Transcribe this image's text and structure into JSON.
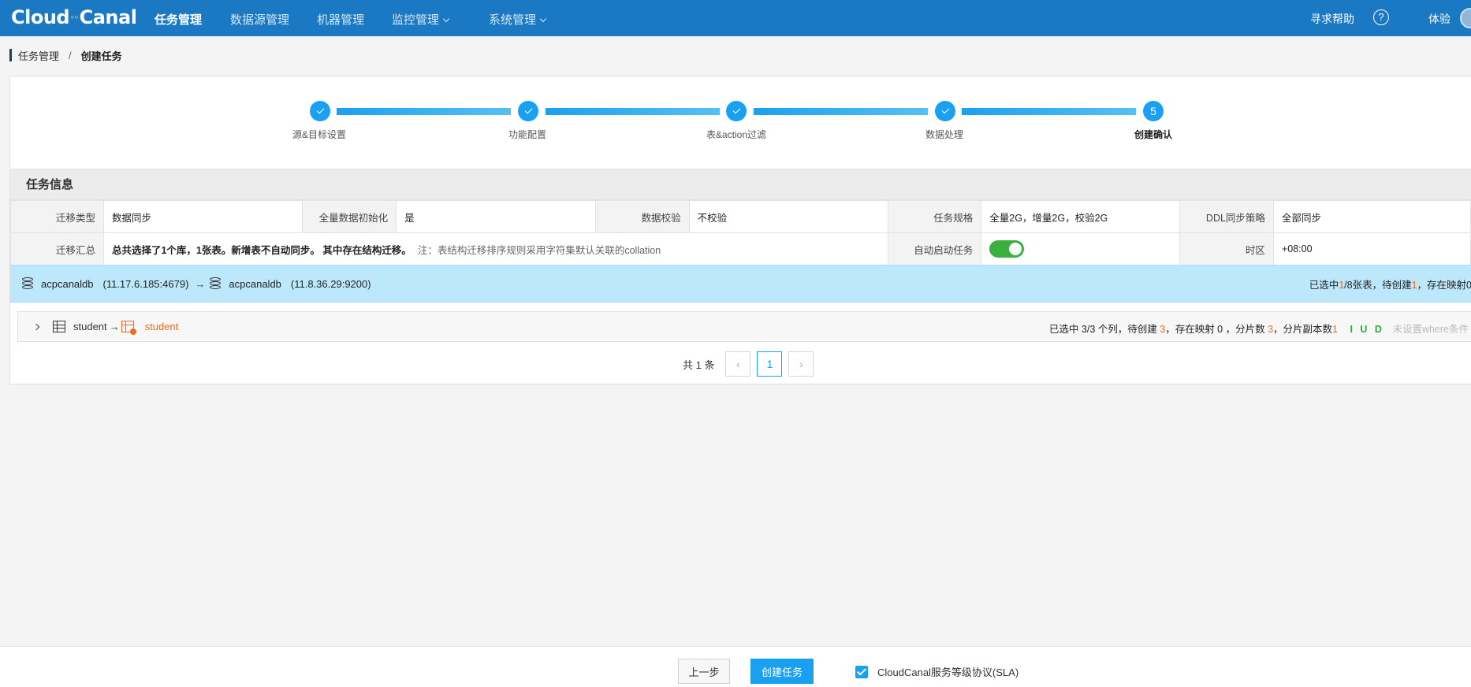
{
  "nav": {
    "logo": "Cloud",
    "logo_mid": "Canal",
    "items": [
      {
        "label": "任务管理"
      },
      {
        "label": "数据源管理"
      },
      {
        "label": "机器管理"
      },
      {
        "label": "监控管理"
      },
      {
        "label": "系统管理"
      }
    ],
    "help": "寻求帮助",
    "help_icon": "?",
    "user": "体验"
  },
  "breadcrumb": {
    "parent": "任务管理",
    "sep": "/",
    "current": "创建任务"
  },
  "steps": [
    {
      "label": "源&目标设置",
      "status": "done"
    },
    {
      "label": "功能配置",
      "status": "done"
    },
    {
      "label": "表&action过滤",
      "status": "done"
    },
    {
      "label": "数据处理",
      "status": "done"
    },
    {
      "label": "创建确认",
      "status": "current",
      "number": "5"
    }
  ],
  "section": {
    "title": "任务信息"
  },
  "info": {
    "row1": [
      {
        "label": "迁移类型",
        "value": "数据同步"
      },
      {
        "label": "全量数据初始化",
        "value": "是"
      },
      {
        "label": "数据校验",
        "value": "不校验"
      },
      {
        "label": "任务规格",
        "value": "全量2G，增量2G，校验2G"
      },
      {
        "label": "DDL同步策略",
        "value": "全部同步"
      }
    ],
    "row2": {
      "summary_label": "迁移汇总",
      "summary": "总共选择了1个库，1张表。新增表不自动同步。 其中存在结构迁移。",
      "note": "注：表结构迁移排序规则采用字符集默认关联的collation",
      "auto_label": "自动启动任务",
      "auto_on": true,
      "tz_label": "时区",
      "tz_value": "+08:00"
    }
  },
  "db": {
    "src_name": "acpcanaldb",
    "src_addr": "(11.17.6.185:4679)",
    "arrow": "→",
    "dst_name": "acpcanaldb",
    "dst_addr": "(11.8.36.29:9200)",
    "summary_pre": "已选中",
    "summary_sel": "1",
    "summary_mid": "/8张表，待创建",
    "summary_create": "1",
    "summary_post": "，存在映射0"
  },
  "table": {
    "src": "student",
    "arrow": "→",
    "dst": "student",
    "cols_text": "已选中 3/3 个列，待创建",
    "cols_create": "3",
    "map_text": "，存在映射 0 ，分片数",
    "shards": "3",
    "replica_text": "，分片副本数",
    "replicas": "1",
    "iud": "I U D",
    "where": "未设置where条件"
  },
  "pager": {
    "total": "共 1 条",
    "prev": "‹",
    "page": "1",
    "next": "›"
  },
  "footer": {
    "prev": "上一步",
    "create": "创建任务",
    "sla": "CloudCanal服务等级协议(SLA)"
  }
}
